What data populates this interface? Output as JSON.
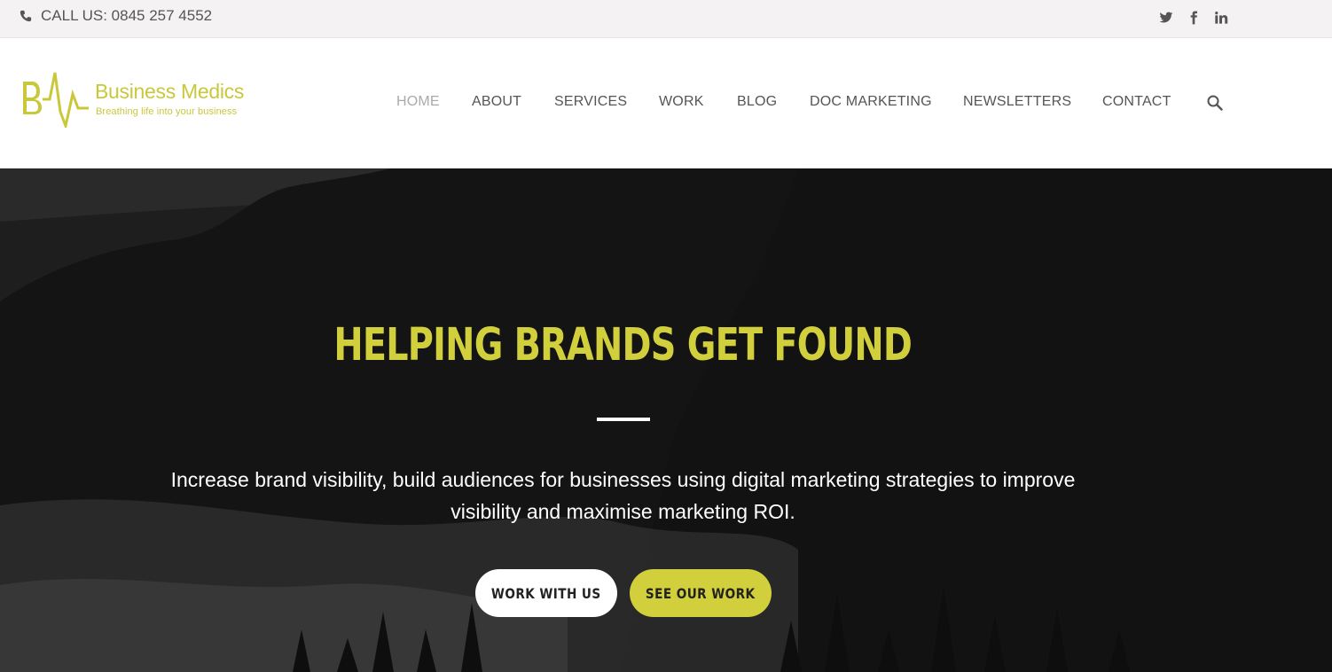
{
  "topbar": {
    "phone_text": "CALL US: 0845 257 4552",
    "phone_icon": "phone-icon",
    "socials": [
      "twitter-icon",
      "facebook-icon",
      "linkedin-icon"
    ]
  },
  "brand": {
    "name": "Business Medics",
    "tagline": "Breathing life into your business",
    "monogram": "BM",
    "color": "#c9c83a"
  },
  "nav": {
    "home": "HOME",
    "about": "ABOUT",
    "services": "SERVICES",
    "work": "WORK",
    "blog": "BLOG",
    "doc_marketing": "DOC MARKETING",
    "newsletters": "NEWSLETTERS",
    "contact": "CONTACT",
    "search_icon": "search-icon",
    "active": "HOME"
  },
  "hero": {
    "title": "HELPING BRANDS GET FOUND",
    "subtitle": "Increase brand visibility, build audiences for businesses using digital marketing strategies to improve visibility and maximise marketing ROI.",
    "primary_button": "WORK WITH US",
    "secondary_button": "SEE OUR WORK",
    "accent_color": "#d1cf3c"
  }
}
